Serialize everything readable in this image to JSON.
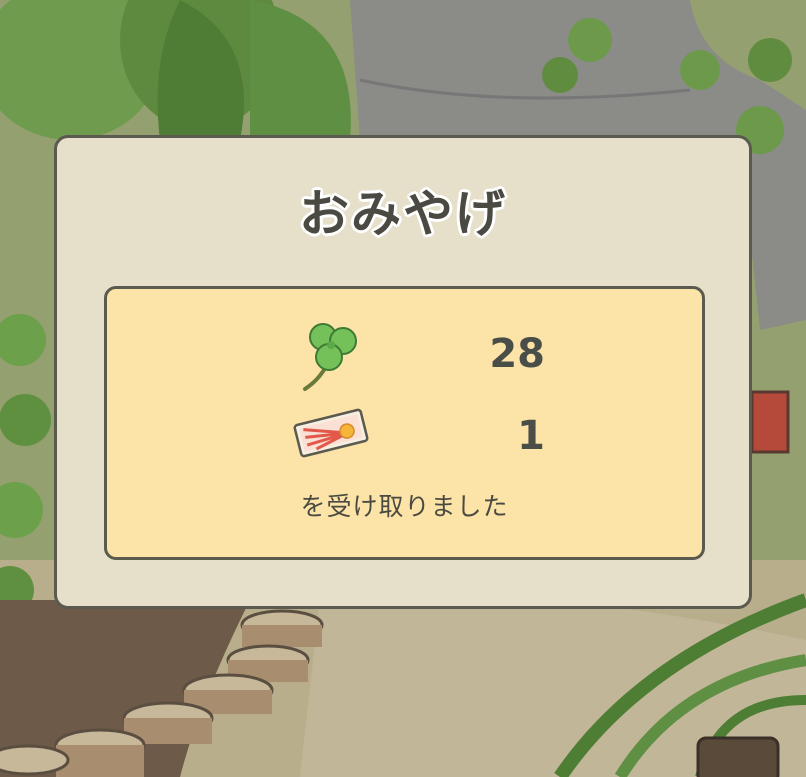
{
  "dialog": {
    "title": "おみやげ",
    "items": [
      {
        "icon": "clover-icon",
        "count": "28"
      },
      {
        "icon": "ticket-icon",
        "count": "1"
      }
    ],
    "message": "を受け取りました"
  },
  "colors": {
    "dialog_bg": "#e6e0cb",
    "panel_bg": "#fce3a7",
    "border": "#5a5a4e",
    "text": "#4a4a42"
  }
}
